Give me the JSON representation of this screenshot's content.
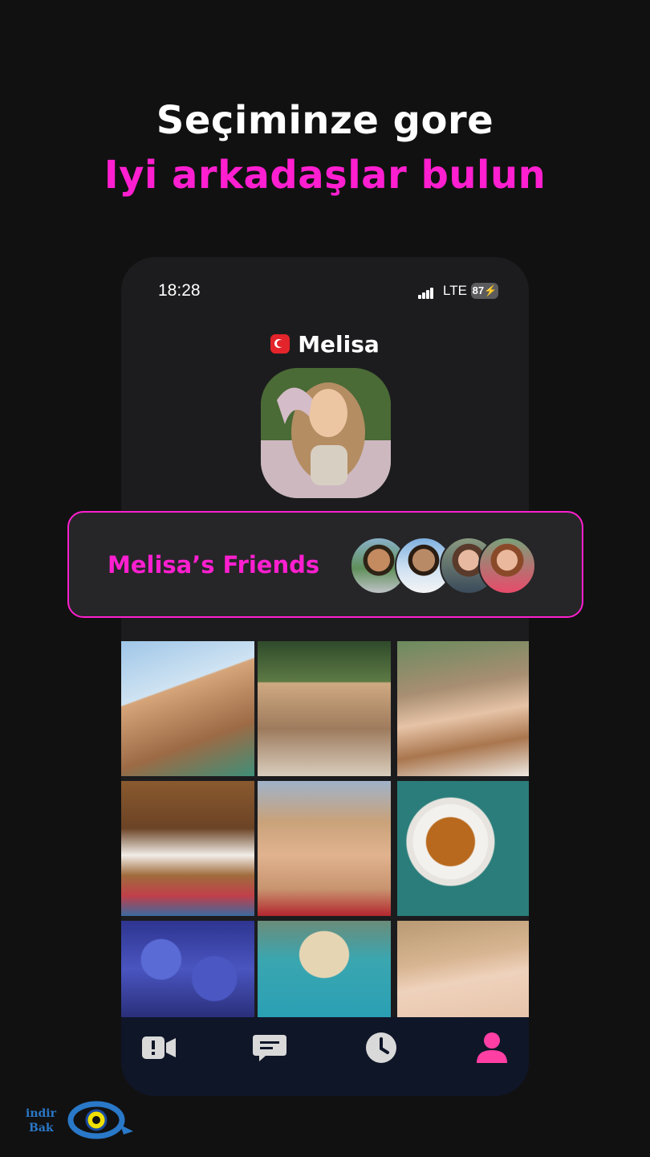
{
  "headline": {
    "line1": "Seçiminze gore",
    "line2": "Iyi arkadaşlar bulun"
  },
  "status_bar": {
    "time": "18:28",
    "network": "LTE",
    "battery": "87"
  },
  "profile": {
    "name": "Melisa",
    "flag_icon": "turkey-flag-icon"
  },
  "friends": {
    "title": "Melisa’s Friends",
    "avatar_count": 4
  },
  "photos": {
    "count": 9,
    "items": [
      "selfie-sky",
      "portrait-forest",
      "portrait-tree",
      "puppy",
      "portrait-sunset",
      "tea-cup",
      "hydrangea-flowers",
      "hat-pool",
      "portrait-closeup"
    ]
  },
  "tabs": [
    {
      "name": "video-chat-icon",
      "active": false
    },
    {
      "name": "messages-icon",
      "active": false
    },
    {
      "name": "history-icon",
      "active": false
    },
    {
      "name": "profile-icon",
      "active": true
    }
  ],
  "colors": {
    "accent": "#ff1fd0",
    "background": "#111111",
    "phone": "#1c1c1e",
    "tab_active": "#ff3fa4",
    "tab_inactive": "#d9d9d9"
  }
}
